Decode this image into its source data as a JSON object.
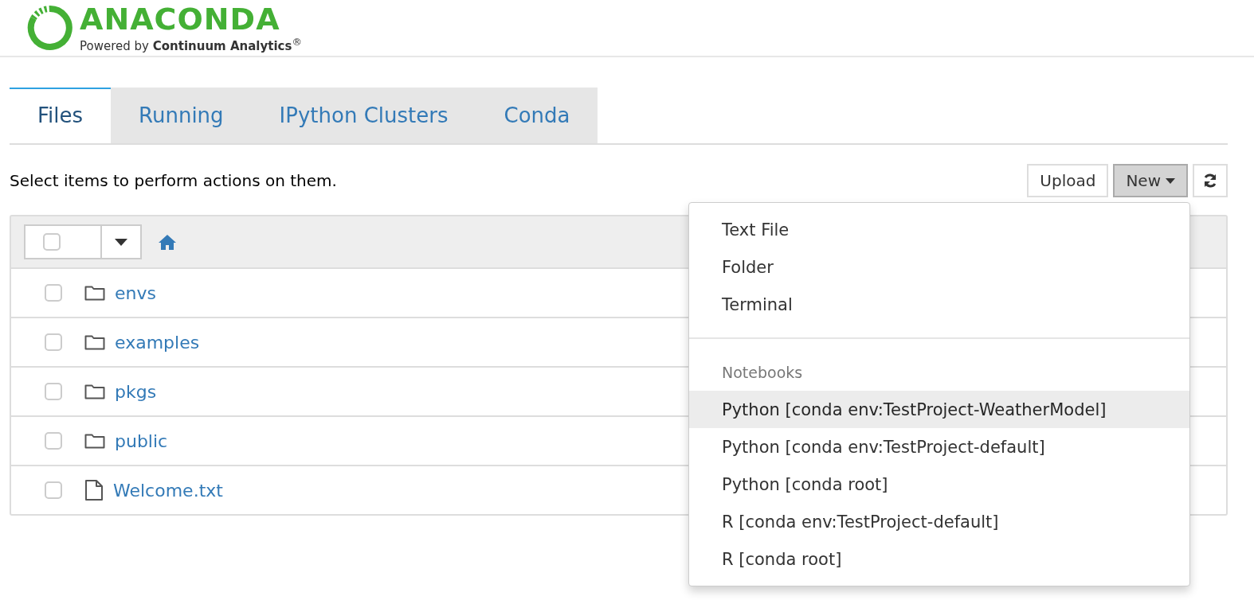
{
  "logo": {
    "wordmark": "ANACONDA",
    "tagline": "Powered by **Continuum Analytics**$^{®}$"
  },
  "tabs": [
    {
      "label": "Files",
      "selected": true
    },
    {
      "label": "Running",
      "selected": false
    },
    {
      "label": "IPython Clusters",
      "selected": false
    },
    {
      "label": "Conda",
      "selected": false
    }
  ],
  "hint": "Select items to perform actions on them.",
  "toolbar": {
    "upload": "Upload",
    "new": "New"
  },
  "list_header": {
    "select_all_checked": false
  },
  "rows": [
    {
      "kind": "folder",
      "name": "envs",
      "checked": false
    },
    {
      "kind": "folder",
      "name": "examples",
      "checked": false
    },
    {
      "kind": "folder",
      "name": "pkgs",
      "checked": false
    },
    {
      "kind": "folder",
      "name": "public",
      "checked": false
    },
    {
      "kind": "file",
      "name": "Welcome.txt",
      "checked": false
    }
  ],
  "new_menu": [
    {
      "kind": "item",
      "label": "Text File",
      "selected": false
    },
    {
      "kind": "item",
      "label": "Folder",
      "selected": false
    },
    {
      "kind": "item",
      "label": "Terminal",
      "selected": false
    },
    {
      "kind": "divider"
    },
    {
      "kind": "header",
      "label": "Notebooks"
    },
    {
      "kind": "item",
      "label": "Python [conda env:TestProject-WeatherModel]",
      "selected": true
    },
    {
      "kind": "item",
      "label": "Python [conda env:TestProject-default]",
      "selected": false
    },
    {
      "kind": "item",
      "label": "Python [conda root]",
      "selected": false
    },
    {
      "kind": "item",
      "label": "R [conda env:TestProject-default]",
      "selected": false
    },
    {
      "kind": "item",
      "label": "R [conda root]",
      "selected": false
    }
  ]
}
